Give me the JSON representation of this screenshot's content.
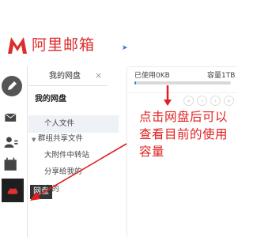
{
  "brand": {
    "name": "阿里邮箱",
    "color": "#dd2c2c"
  },
  "rail": {
    "items": [
      {
        "icon": "pencil-icon"
      },
      {
        "icon": "mail-icon"
      },
      {
        "icon": "contacts-icon"
      },
      {
        "icon": "calendar-icon"
      },
      {
        "icon": "cloud-icon"
      }
    ],
    "cloud_tooltip": "网盘"
  },
  "tab": {
    "label": "我的网盘"
  },
  "panel": {
    "title": "我的网盘",
    "tree": {
      "personal": "个人文件",
      "group": "群组共享文件",
      "attachment_transfer": "大附件中转站",
      "shared_by_me": "分享给我的",
      "shared_with_me": "享的"
    }
  },
  "storage": {
    "used_label": "已使用0KB",
    "capacity_label": "容量1TB",
    "used_fraction": 0.02
  },
  "pager": [
    "«",
    "‹",
    "›",
    "»"
  ],
  "annotation": {
    "text": "点击网盘后可以查看目前的使用容量",
    "color": "#e02020"
  }
}
